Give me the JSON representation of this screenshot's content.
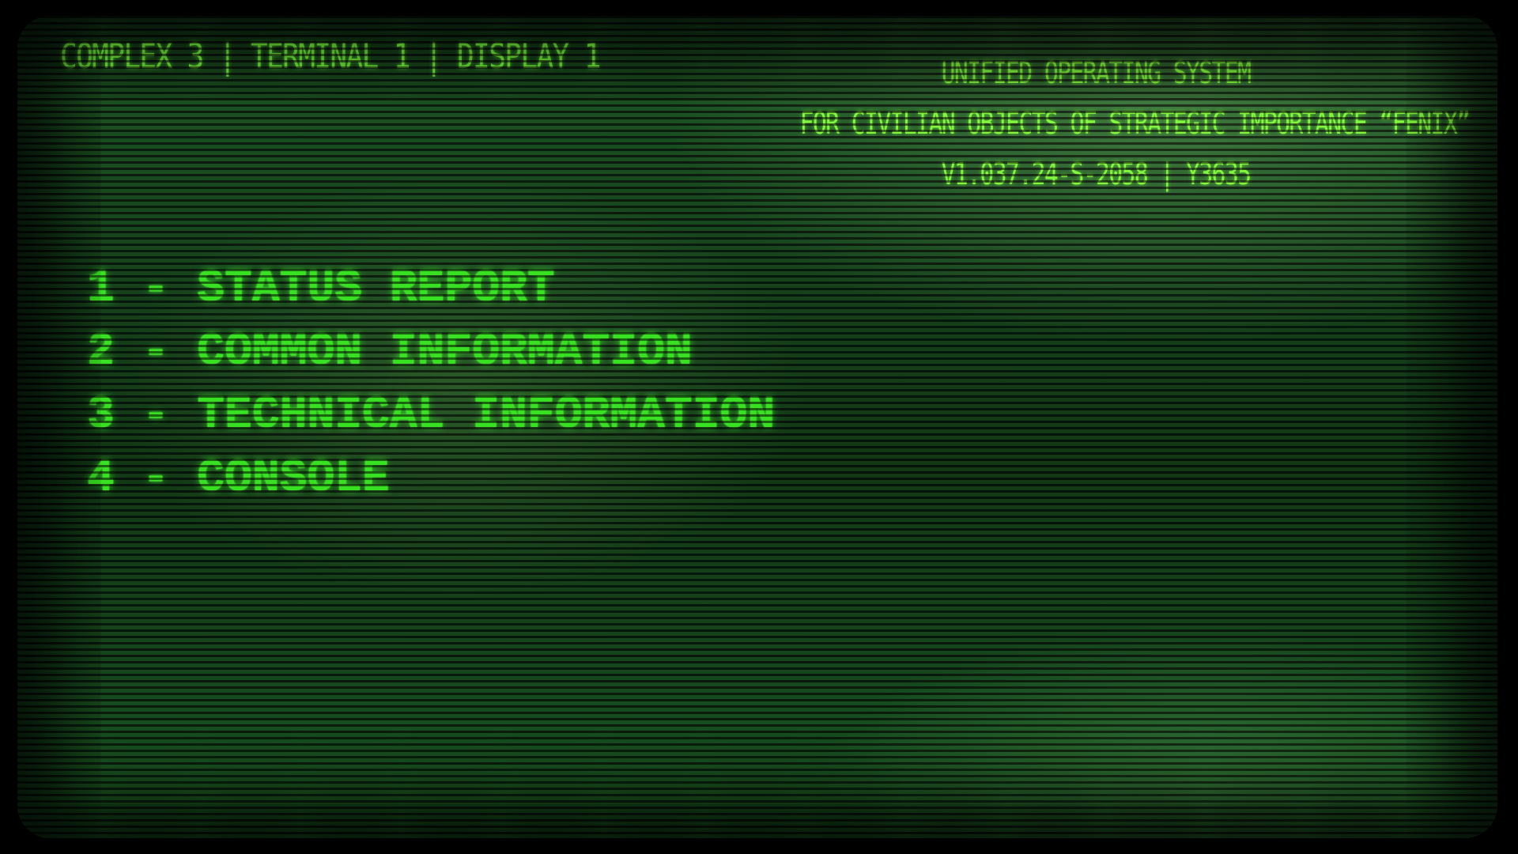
{
  "header": {
    "location": "COMPLEX 3 | TERMINAL 1 | DISPLAY 1",
    "system_title": "UNIFIED OPERATING SYSTEM",
    "system_subtitle": "FOR CIVILIAN OBJECTS OF STRATEGIC IMPORTANCE “FENIX”",
    "version": "V1.037.24-S-2058 | Y3635"
  },
  "menu": {
    "items": [
      {
        "label": "1 - STATUS REPORT"
      },
      {
        "label": "2 - COMMON INFORMATION"
      },
      {
        "label": "3 - TECHNICAL INFORMATION"
      },
      {
        "label": "4 - CONSOLE"
      }
    ]
  },
  "colors": {
    "text_primary": "#37e61e",
    "header_text": "#7dff3a",
    "screen_background": "#113318",
    "bezel": "#000000"
  }
}
